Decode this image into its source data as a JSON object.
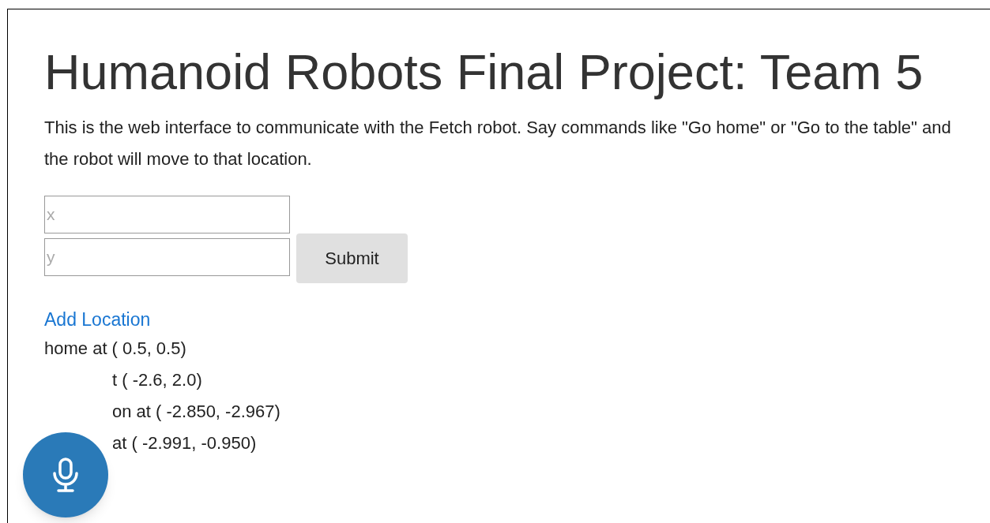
{
  "title": "Humanoid Robots Final Project: Team 5",
  "description": "This is the web interface to communicate with the Fetch robot. Say commands like \"Go home\" or \"Go to the table\" and the robot will move to that location.",
  "form": {
    "fields": [
      {
        "placeholder": "x"
      },
      {
        "placeholder": "y"
      }
    ],
    "submit": "Submit"
  },
  "add_location": "Add Location",
  "locations": [
    {
      "text": "home at ( 0.5, 0.5)",
      "kind": "full"
    },
    {
      "text": "t ( -2.6, 2.0)",
      "kind": "covered"
    },
    {
      "text": "on at ( -2.850, -2.967)",
      "kind": "covered"
    },
    {
      "text": "at ( -2.991, -0.950)",
      "kind": "covered"
    }
  ]
}
